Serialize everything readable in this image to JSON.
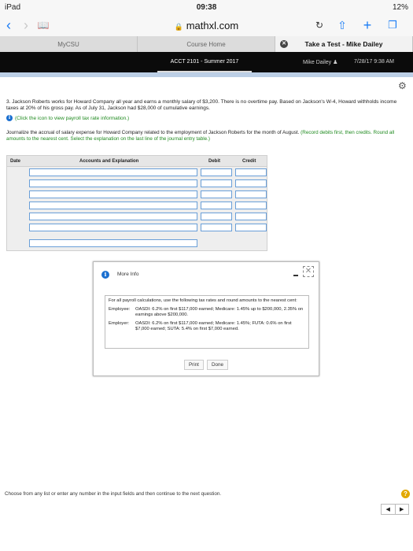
{
  "statusbar": {
    "device": "iPad",
    "time": "09:38",
    "battery": "12%"
  },
  "browser": {
    "url": "mathxl.com"
  },
  "tabs": [
    {
      "label": "MyCSU"
    },
    {
      "label": "Course Home"
    },
    {
      "label": "Take a Test - Mike Dailey"
    }
  ],
  "appbar": {
    "course": "ACCT 2101 - Summer 2017",
    "user": "Mike Dailey",
    "datetime": "7/28/17 9:38 AM"
  },
  "question": {
    "text": "3. Jackson Roberts works for Howard Company all year and earns a monthly salary of $3,200. There is no overtime pay. Based on Jackson's W-4, Howard withholds income taxes at 20% of his gross pay. As of July 31, Jackson had $28,000 of cumulative earnings.",
    "info_link": "(Click the icon to view payroll tax rate information.)",
    "instruction": "Journalize the accrual of salary expense for Howard Company related to the employment of Jackson Roberts for the month of August.",
    "instruction_green": "(Record debits first, then credits. Round all amounts to the nearest cent. Select the explanation on the last line of the journal entry table.)"
  },
  "journal": {
    "headers": {
      "date": "Date",
      "accounts": "Accounts and Explanation",
      "debit": "Debit",
      "credit": "Credit"
    }
  },
  "modal": {
    "title": "More Info",
    "intro": "For all payroll calculations, use the following tax rates and round amounts to the nearest cent:",
    "employee_label": "Employee:",
    "employee_text": "OASDI: 6.2% on first $117,000 earned; Medicare: 1.45% up to $200,000, 2.35% on earnings above $200,000.",
    "employer_label": "Employer:",
    "employer_text": "OASDI: 6.2% on first $117,000 earned; Medicare: 1.45%; FUTA: 0.6% on first $7,000 earned; SUTA: 5.4% on first $7,000 earned.",
    "print_label": "Print",
    "done_label": "Done"
  },
  "footer": {
    "text": "Choose from any list or enter any number in the input fields and then continue to the next question."
  },
  "icons": {
    "help": "help-icon",
    "gear": "gear-icon",
    "info": "info-icon"
  }
}
